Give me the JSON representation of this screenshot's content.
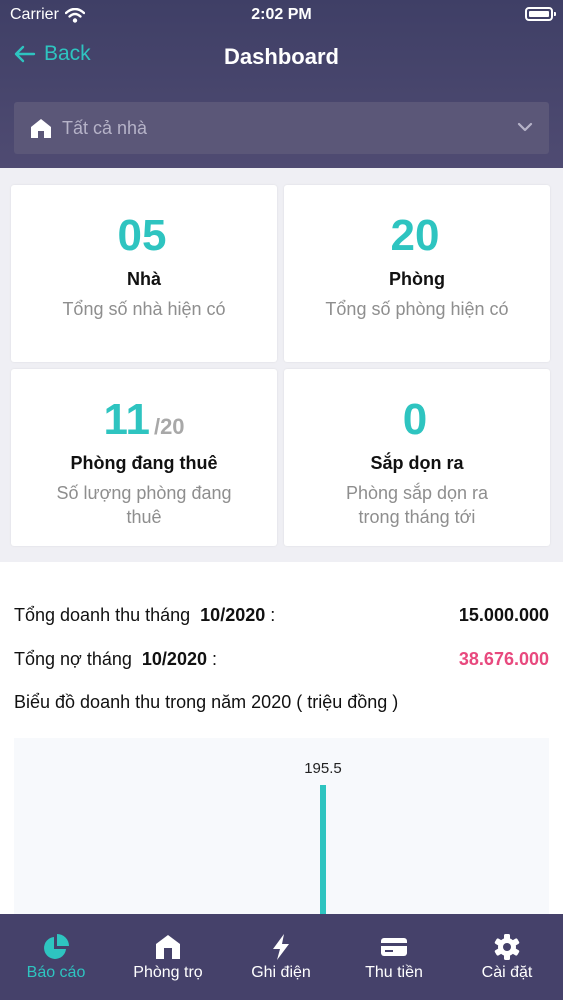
{
  "status_bar": {
    "carrier": "Carrier",
    "time": "2:02 PM"
  },
  "header": {
    "back_label": "Back",
    "title": "Dashboard"
  },
  "house_filter": {
    "selected": "Tất cả nhà"
  },
  "stats": [
    {
      "value": "05",
      "suffix": "",
      "title": "Nhà",
      "desc": "Tổng số nhà hiện có"
    },
    {
      "value": "20",
      "suffix": "",
      "title": "Phòng",
      "desc": "Tổng số phòng hiện có"
    },
    {
      "value": "11",
      "suffix": "/20",
      "title": "Phòng đang thuê",
      "desc": "Số lượng phòng đang thuê"
    },
    {
      "value": "0",
      "suffix": "",
      "title": "Sắp dọn ra",
      "desc": "Phòng sắp dọn ra trong tháng tới"
    }
  ],
  "summary": {
    "revenue_label": "Tổng doanh thu tháng",
    "revenue_month": "10/2020",
    "revenue_value": "15.000.000",
    "debt_label": "Tổng nợ tháng",
    "debt_month": "10/2020",
    "debt_value": "38.676.000",
    "colon": ":"
  },
  "chart_title": "Biểu đồ doanh thu trong năm 2020 ( triệu đồng )",
  "chart_data": {
    "type": "bar",
    "title": "Biểu đồ doanh thu trong năm 2020 ( triệu đồng )",
    "values": [
      195.5
    ],
    "data_labels": [
      "195.5"
    ],
    "color": "#2ec4c0"
  },
  "tabs": [
    {
      "label": "Báo cáo",
      "icon": "pie-chart-icon",
      "active": true
    },
    {
      "label": "Phòng trọ",
      "icon": "house-icon",
      "active": false
    },
    {
      "label": "Ghi điện",
      "icon": "lightning-icon",
      "active": false
    },
    {
      "label": "Thu tiền",
      "icon": "card-icon",
      "active": false
    },
    {
      "label": "Cài đặt",
      "icon": "gear-icon",
      "active": false
    }
  ],
  "colors": {
    "accent": "#2ec4c0",
    "debt": "#e8497e",
    "header": "#45416a"
  }
}
